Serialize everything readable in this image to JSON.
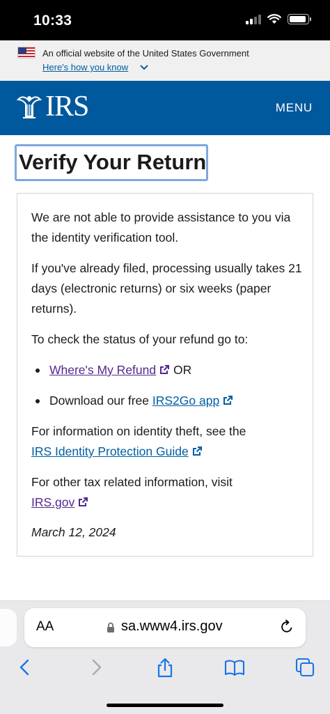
{
  "status_bar": {
    "time": "10:33"
  },
  "gov_banner": {
    "text": "An official website of the United States Government",
    "link": "Here's how you know"
  },
  "header": {
    "logo_text": "IRS",
    "menu_label": "MENU"
  },
  "page": {
    "title": "Verify Your Return",
    "para1": "We are not able to provide assistance to you via the identity verification tool.",
    "para2": "If you've already filed, processing usually takes 21 days (electronic returns) or six weeks (paper returns).",
    "para3": "To check the status of your refund go to:",
    "bullet1_link": "Where's My Refund",
    "bullet1_suffix": " OR",
    "bullet2_prefix": "Download our free ",
    "bullet2_link": "IRS2Go app",
    "para4_text": "For information on identity theft, see the",
    "para4_link": "IRS Identity Protection Guide",
    "para5_text": "For other tax related information, visit",
    "para5_link": "IRS.gov",
    "date": "March 12, 2024"
  },
  "browser": {
    "aa_label": "AA",
    "url": "sa.www4.irs.gov"
  },
  "colors": {
    "header_blue": "#00599c",
    "link_blue": "#005ea2",
    "visited_purple": "#54278f",
    "title_focus_outline": "#7ea7e0"
  }
}
